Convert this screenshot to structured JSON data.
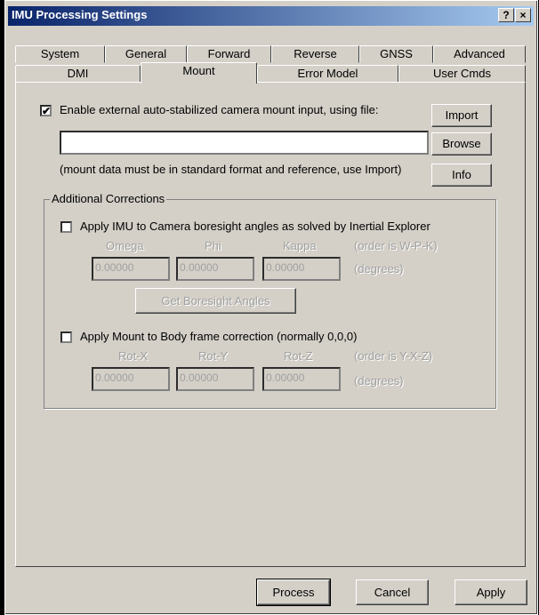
{
  "window": {
    "title": "IMU Processing Settings",
    "help_btn": "?",
    "close_btn": "×"
  },
  "tabs_back": [
    "System",
    "General",
    "Forward",
    "Reverse",
    "GNSS",
    "Advanced"
  ],
  "tabs_front": [
    "DMI",
    "Mount",
    "Error Model",
    "User Cmds"
  ],
  "active_tab": "Mount",
  "mount": {
    "enable_check": "✔",
    "enable_label": "Enable external auto-stabilized camera mount input, using file:",
    "file_value": "",
    "note": "(mount data must be in standard format and reference, use Import)",
    "import_btn": "Import",
    "browse_btn": "Browse",
    "info_btn": "Info"
  },
  "corrections": {
    "title": "Additional Corrections",
    "boresight_label": "Apply IMU to Camera boresight angles as solved by Inertial Explorer",
    "omega": "Omega",
    "phi": "Phi",
    "kappa": "Kappa",
    "order1": "(order is W-P-K)",
    "omega_val": "0.00000",
    "phi_val": "0.00000",
    "kappa_val": "0.00000",
    "deg1": "(degrees)",
    "get_btn": "Get Boresight Angles",
    "mount_label": "Apply Mount to Body frame correction (normally 0,0,0)",
    "rotx": "Rot-X",
    "roty": "Rot-Y",
    "rotz": "Rot-Z",
    "order2": "(order is Y-X-Z)",
    "rotx_val": "0.00000",
    "roty_val": "0.00000",
    "rotz_val": "0.00000",
    "deg2": "(degrees)"
  },
  "footer": {
    "process": "Process",
    "cancel": "Cancel",
    "apply": "Apply"
  }
}
